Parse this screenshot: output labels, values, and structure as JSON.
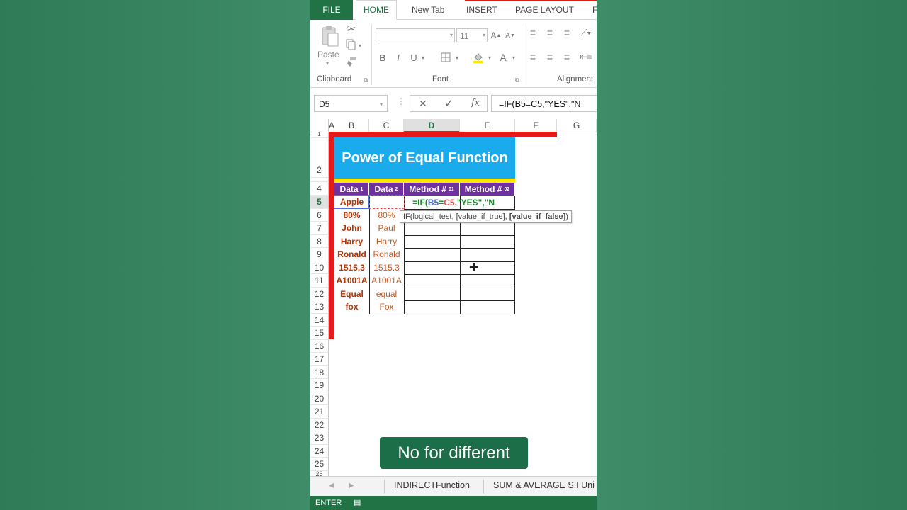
{
  "ribbon": {
    "tabs": [
      "FILE",
      "HOME",
      "New Tab",
      "INSERT",
      "PAGE LAYOUT",
      "F"
    ],
    "active_tab": "HOME",
    "clipboard": {
      "paste_label": "Paste",
      "group_label": "Clipboard"
    },
    "font": {
      "size": "11",
      "group_label": "Font",
      "bold": "B",
      "italic": "I",
      "underline": "U"
    },
    "alignment": {
      "group_label": "Alignment"
    }
  },
  "formula_bar": {
    "name_box": "D5",
    "cancel": "✕",
    "enter": "✓",
    "fx": "fx",
    "formula": "=IF(B5=C5,\"YES\",\"N"
  },
  "grid": {
    "columns": [
      "A",
      "B",
      "C",
      "D",
      "E",
      "F",
      "G"
    ],
    "selected_column": "D",
    "rows": [
      "1",
      "2",
      "",
      "4",
      "5",
      "6",
      "7",
      "8",
      "9",
      "10",
      "11",
      "12",
      "13",
      "14",
      "15",
      "16",
      "17",
      "18",
      "19",
      "20",
      "21",
      "22",
      "23",
      "24",
      "25",
      "26"
    ],
    "selected_row": "5",
    "title": "Power of Equal Function",
    "headers": [
      {
        "label": "Data",
        "num": "1"
      },
      {
        "label": "Data",
        "num": "2"
      },
      {
        "label": "Method # ",
        "num": "01"
      },
      {
        "label": "Method # ",
        "num": "02"
      }
    ],
    "data1": [
      "Apple",
      "80%",
      "John",
      "Harry",
      "Ronald",
      "1515.3",
      "A1001A",
      "Equal",
      "fox"
    ],
    "data2": [
      "",
      "80%",
      "Paul",
      "Harry",
      "Ronald",
      "1515.3",
      "A1001A",
      "equal",
      "Fox"
    ],
    "editing_formula": {
      "prefix": "=IF(",
      "ref1": "B5",
      "eq": "=",
      "ref2": "C5",
      "rest": ",\"YES\",\"N"
    },
    "tooltip": {
      "text": "IF(logical_test, [value_if_true], ",
      "bold": "[value_if_false]",
      "end": ")"
    }
  },
  "sheets": [
    "INDIRECTFunction",
    "SUM & AVERAGE S.I Uni"
  ],
  "status": {
    "mode": "ENTER"
  },
  "caption": "No for different",
  "colors": {
    "excel_green": "#217346",
    "title_blue": "#1aabec",
    "header_purple": "#7030a0",
    "accent_red": "#e21a1a"
  }
}
